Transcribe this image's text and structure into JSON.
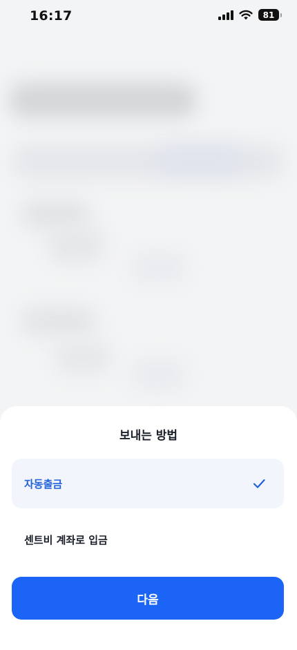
{
  "status_bar": {
    "time": "16:17",
    "battery_level": "81",
    "icons": [
      "signal-icon",
      "wifi-icon",
      "battery-icon"
    ]
  },
  "sheet": {
    "title": "보내는 방법",
    "options": [
      {
        "label": "자동출금",
        "selected": true
      },
      {
        "label": "센트비 계좌로 입금",
        "selected": false
      }
    ],
    "selected_icon": "check-icon",
    "next_label": "다음"
  },
  "colors": {
    "accent": "#1b64f5",
    "selected_text": "#2060d8",
    "selected_bg": "#f2f5fb",
    "sheet_bg": "#ffffff",
    "backdrop": "#f3f4f5"
  }
}
